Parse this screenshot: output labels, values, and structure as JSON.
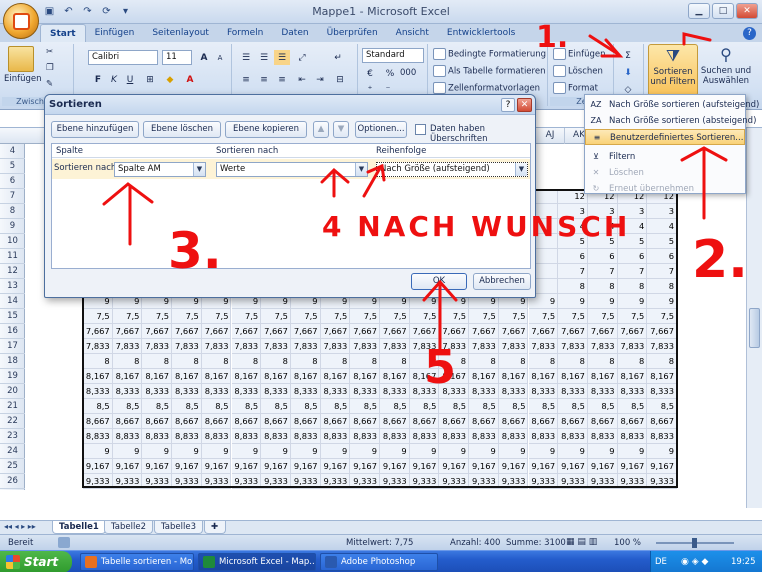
{
  "window": {
    "title": "Mappe1 - Microsoft Excel",
    "help": "?"
  },
  "ribbon_tabs": [
    "Start",
    "Einfügen",
    "Seitenlayout",
    "Formeln",
    "Daten",
    "Überprüfen",
    "Ansicht",
    "Entwicklertools"
  ],
  "ribbon": {
    "paste_label": "Einfügen",
    "clipboard_group": "Zwischena",
    "font_name": "Calibri",
    "font_size": "11",
    "number_format": "Standard",
    "percent": "%",
    "thousands": "000",
    "cond_format": "Bedingte Formatierung",
    "as_table": "Als Tabelle formatieren",
    "cell_styles": "Zellenformatvorlagen",
    "insert": "Einfügen",
    "delete": "Löschen",
    "format": "Format",
    "cells_group": "Ze",
    "sort_filter": "Sortieren und Filtern",
    "find_select": "Suchen und Auswählen",
    "bold": "F",
    "italic": "K",
    "underline": "U"
  },
  "dialog": {
    "title": "Sortieren",
    "help": "?",
    "add_level": "Ebene hinzufügen",
    "delete_level": "Ebene löschen",
    "copy_level": "Ebene kopieren",
    "options": "Optionen...",
    "headers_checkbox": "Daten haben Überschriften",
    "col_spalte": "Spalte",
    "col_sort_on": "Sortieren nach",
    "col_order": "Reihenfolge",
    "row_label": "Sortieren nach",
    "column_value": "Spalte AM",
    "sort_on_value": "Werte",
    "order_value": "Nach Größe (aufsteigend)",
    "ok": "OK",
    "cancel": "Abbrechen"
  },
  "menu": {
    "items": [
      {
        "label": "Nach Größe sortieren (aufsteigend)",
        "icon": "AZ",
        "state": "normal"
      },
      {
        "label": "Nach Größe sortieren (absteigend)",
        "icon": "ZA",
        "state": "normal"
      },
      {
        "label": "Benutzerdefiniertes Sortieren...",
        "icon": "≡",
        "state": "highlighted"
      },
      {
        "label": "Filtern",
        "icon": "⊻",
        "state": "normal"
      },
      {
        "label": "Löschen",
        "icon": "✕",
        "state": "disabled"
      },
      {
        "label": "Erneut übernehmen",
        "icon": "↻",
        "state": "disabled"
      }
    ]
  },
  "sheet": {
    "visible_cols_right": [
      "AJ",
      "AK"
    ],
    "row_numbers": [
      "4",
      "5",
      "6",
      "7",
      "8",
      "9",
      "10",
      "11",
      "12",
      "13",
      "14",
      "15",
      "16",
      "17",
      "18",
      "19",
      "20",
      "21",
      "22",
      "23",
      "24",
      "25",
      "26"
    ],
    "right_col_values": {
      "7": "12",
      "8": "3",
      "9": "4",
      "10": "5",
      "11": "6",
      "12": "7",
      "13": "8",
      "14": "8"
    },
    "row_values": {
      "14": "9",
      "15": "7,5",
      "16": "7,667",
      "17": "7,833",
      "18": "8",
      "19": "8,167",
      "20": "8,333",
      "21": "8,5",
      "22": "8,667",
      "23": "8,833",
      "24": "9",
      "25": "9,167",
      "26": "9,333"
    },
    "tabs": [
      "Tabelle1",
      "Tabelle2",
      "Tabelle3"
    ]
  },
  "status": {
    "mode": "Bereit",
    "average": "Mittelwert: 7,75",
    "count": "Anzahl: 400",
    "sum": "Summe: 3100",
    "zoom": "100 %"
  },
  "taskbar": {
    "start": "Start",
    "items": [
      "Tabelle sortieren - Mo...",
      "Microsoft Excel - Map...",
      "Adobe Photoshop"
    ],
    "lang": "DE",
    "time": "19:25"
  },
  "annotations": {
    "one": "1.",
    "two": "2.",
    "three": "3.",
    "four": "4 NACH WUNSCH",
    "five": "5"
  },
  "colors": {
    "annotation": "#ee1010",
    "ribbon": "#d3e1f3",
    "accent": "#f8c25a"
  }
}
